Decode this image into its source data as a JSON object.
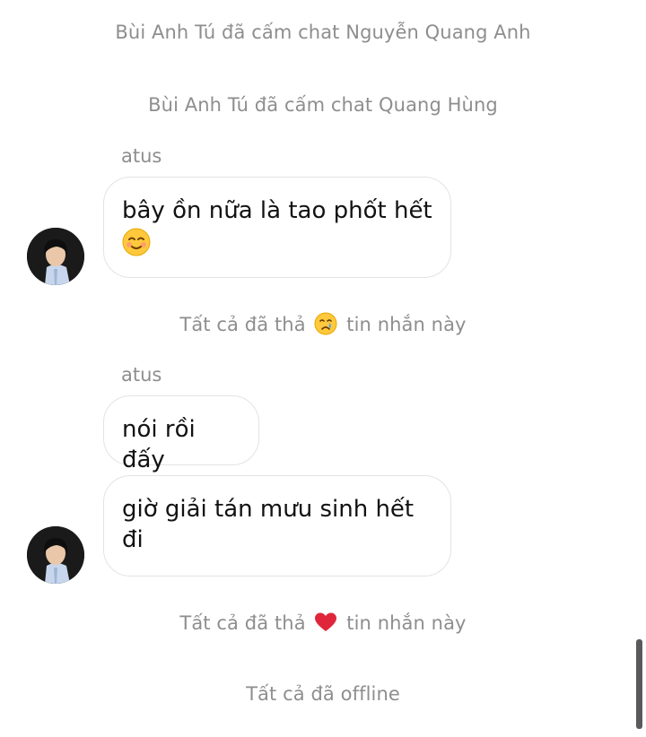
{
  "system_messages": [
    {
      "text": "Bùi Anh Tú đã cấm chat Nguyễn Quang Anh"
    },
    {
      "text": "Bùi Anh Tú đã cấm chat Quang Hùng"
    },
    {
      "before": "Tất cả đã thả",
      "emoji": "crying-face-icon",
      "after": "tin nhắn này"
    },
    {
      "before": "Tất cả đã thả",
      "emoji": "red-heart-icon",
      "after": "tin nhắn này"
    },
    {
      "text": "Tất cả đã offline"
    }
  ],
  "groups": [
    {
      "sender": "atus",
      "messages": [
        {
          "line1": "bây ồn nữa là tao phốt hết",
          "emoji": "smiling-face-icon"
        }
      ]
    },
    {
      "sender": "atus",
      "messages": [
        {
          "line1": "nói rồi đấy"
        },
        {
          "line1": "giờ giải tán mưu sinh hết",
          "line2": "đi"
        }
      ]
    }
  ],
  "colors": {
    "system_text": "#8e8e8e",
    "bubble_border": "#e3e3e3",
    "message_text": "#121212",
    "heart": "#e0263a",
    "emoji_yellow": "#ffc83d"
  }
}
